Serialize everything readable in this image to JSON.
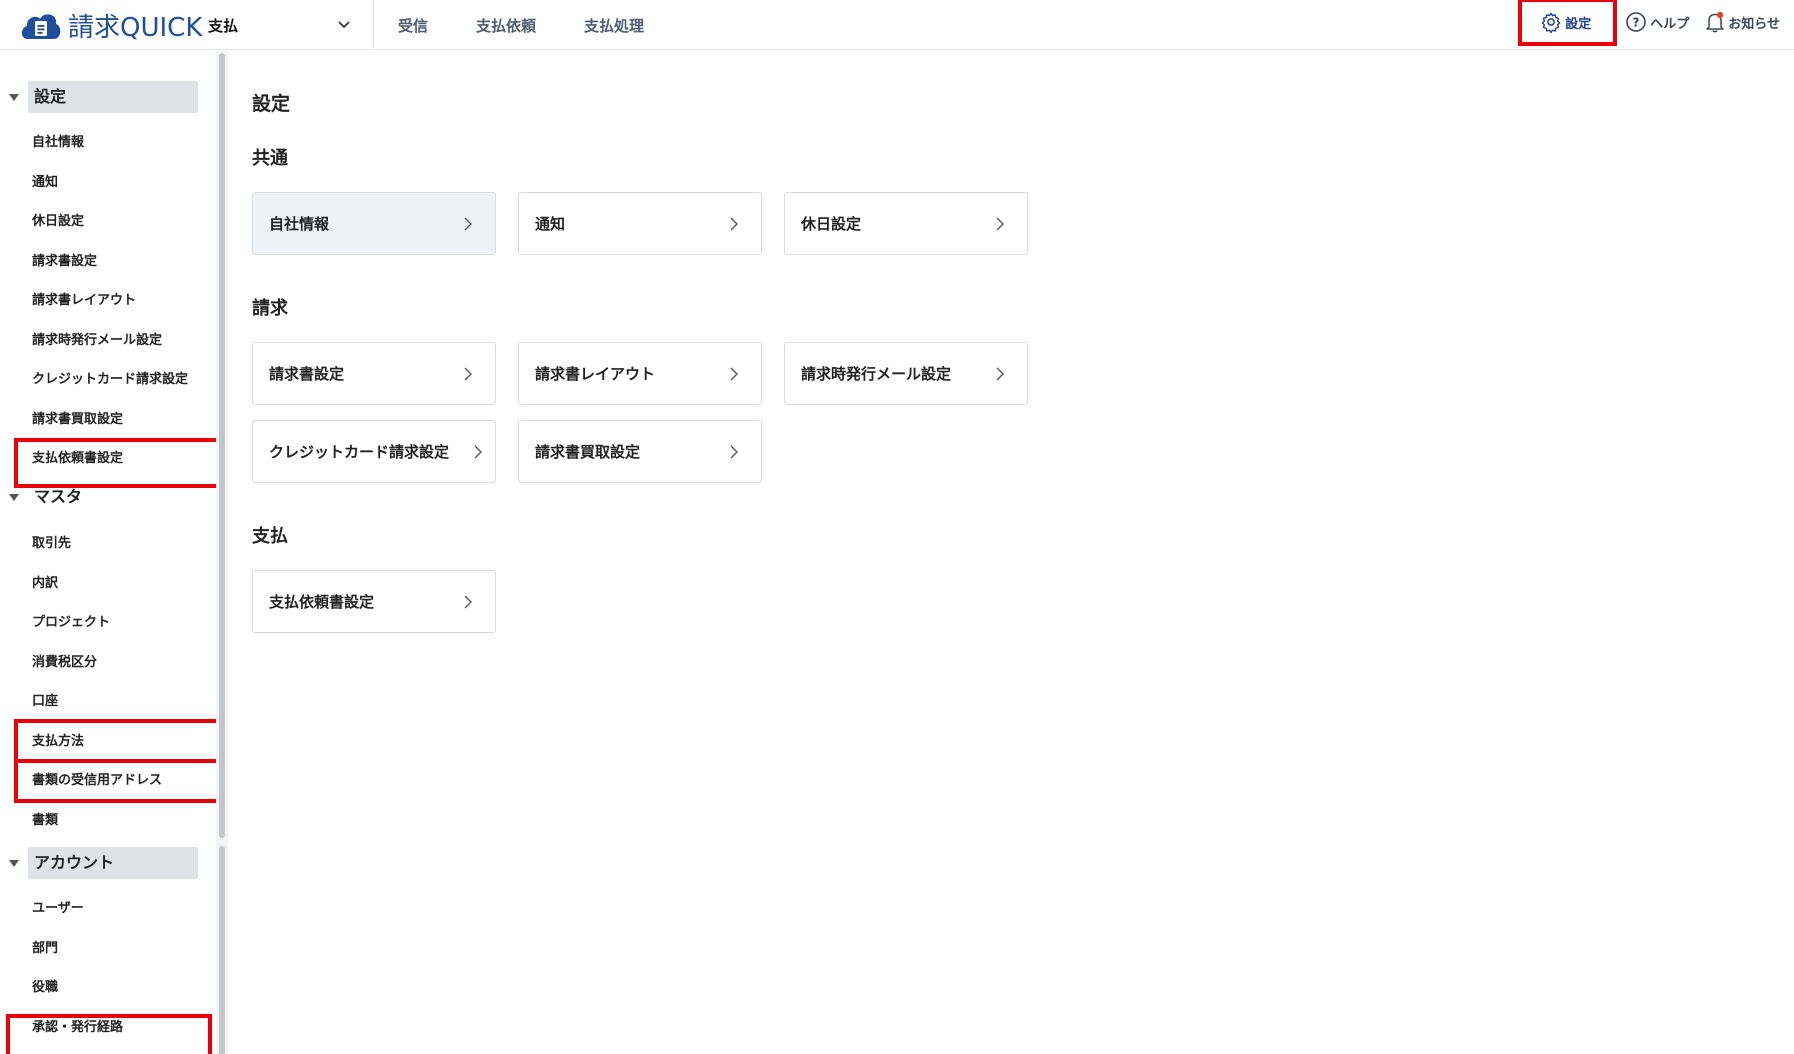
{
  "header": {
    "logo_text": "請求QUICK",
    "module": "支払",
    "tabs": [
      "受信",
      "支払依頼",
      "支払処理"
    ],
    "actions": {
      "settings": "設定",
      "help": "ヘルプ",
      "notifications": "お知らせ"
    }
  },
  "sidebar": {
    "groups": [
      {
        "label": "設定",
        "items": [
          "自社情報",
          "通知",
          "休日設定",
          "請求書設定",
          "請求書レイアウト",
          "請求時発行メール設定",
          "クレジットカード請求設定",
          "請求書買取設定",
          "支払依頼書設定"
        ]
      },
      {
        "label": "マスタ",
        "items": [
          "取引先",
          "内訳",
          "プロジェクト",
          "消費税区分",
          "口座",
          "支払方法",
          "書類の受信用アドレス",
          "書類"
        ]
      },
      {
        "label": "アカウント",
        "items": [
          "ユーザー",
          "部門",
          "役職",
          "承認・発行経路"
        ]
      }
    ]
  },
  "main": {
    "title": "設定",
    "sections": [
      {
        "title": "共通",
        "cards": [
          "自社情報",
          "通知",
          "休日設定"
        ]
      },
      {
        "title": "請求",
        "cards": [
          "請求書設定",
          "請求書レイアウト",
          "請求時発行メール設定",
          "クレジットカード請求設定",
          "請求書買取設定"
        ]
      },
      {
        "title": "支払",
        "cards": [
          "支払依頼書設定"
        ]
      }
    ]
  },
  "colors": {
    "brand": "#1f4e9c",
    "highlight": "#e8000b",
    "active_bg": "#dfe3e9"
  }
}
